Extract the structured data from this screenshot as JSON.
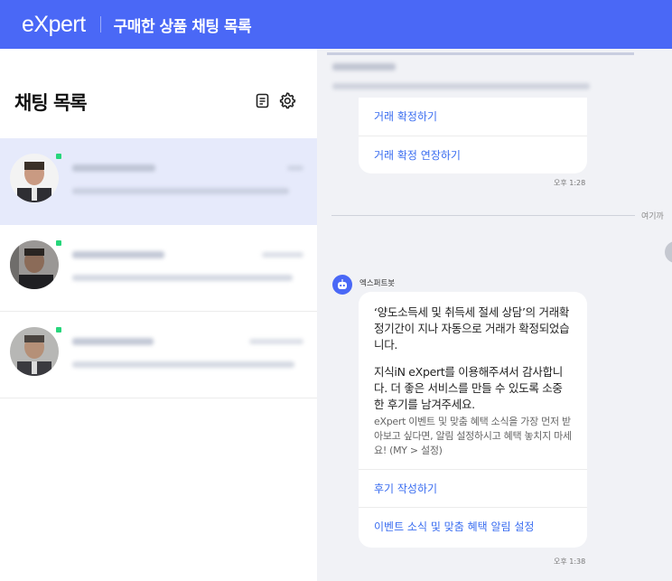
{
  "header": {
    "logo": "eXpert",
    "title": "구매한 상품 채팅 목록",
    "background": "#4a68f6"
  },
  "sidebar": {
    "title": "채팅 목록",
    "icons": [
      "memo-icon",
      "gear-icon"
    ],
    "chats": [
      {
        "active": true,
        "online": true
      },
      {
        "active": false,
        "online": true
      },
      {
        "active": false,
        "online": true
      }
    ]
  },
  "conversation": {
    "prev_actions": [
      "거래 확정하기",
      "거래 확정 연장하기"
    ],
    "prev_time": "오후 1:28",
    "separator_text": "여기까",
    "bot_name": "엑스퍼트봇",
    "bot_message": {
      "p1": "‘양도소득세 및 취득세 절세 상담’의 거래확정기간이 지나 자동으로 거래가 확정되었습니다.",
      "p2": "지식iN eXpert를 이용해주셔서 감사합니다. 더 좋은 서비스를 만들 수 있도록 소중한 후기를 남겨주세요.",
      "p3": "eXpert 이벤트 및 맞춤 혜택 소식을 가장 먼저 받아보고 싶다면, 알림 설정하시고 혜택 놓치지 마세요! (MY > 설정)"
    },
    "bot_actions": [
      "후기 작성하기",
      "이벤트 소식 및 맞춤 혜택 알림 설정"
    ],
    "bot_time": "오후 1:38",
    "accent": "#3a6df0"
  }
}
